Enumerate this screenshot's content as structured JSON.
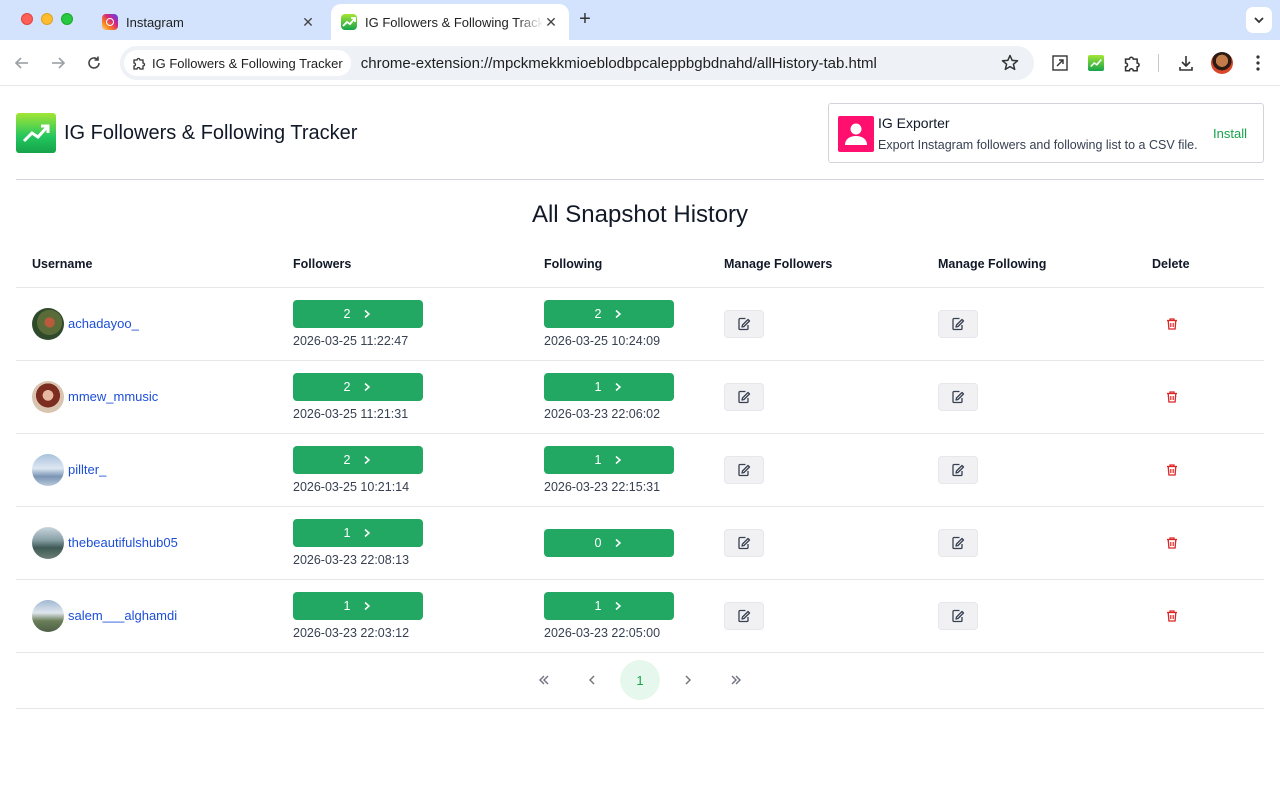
{
  "browser": {
    "tabs": [
      {
        "title": "Instagram",
        "active": false
      },
      {
        "title": "IG Followers & Following Tracker",
        "active": true
      }
    ],
    "origin_chip": "IG Followers & Following Tracker",
    "url": "chrome-extension://mpckmekkmioeblodbpcaleppbgbdnahd/allHistory-tab.html"
  },
  "header": {
    "app_title": "IG Followers & Following Tracker",
    "promo": {
      "title": "IG Exporter",
      "description": "Export Instagram followers and following list to a CSV file.",
      "action": "Install"
    }
  },
  "page_title": "All Snapshot History",
  "table": {
    "columns": [
      "Username",
      "Followers",
      "Following",
      "Manage Followers",
      "Manage Following",
      "Delete"
    ],
    "rows": [
      {
        "username": "achadayoo_",
        "followers": "2",
        "followers_time": "2026-03-25 11:22:47",
        "following": "2",
        "following_time": "2026-03-25 10:24:09"
      },
      {
        "username": "mmew_mmusic",
        "followers": "2",
        "followers_time": "2026-03-25 11:21:31",
        "following": "1",
        "following_time": "2026-03-23 22:06:02"
      },
      {
        "username": "pillter_",
        "followers": "2",
        "followers_time": "2026-03-25 10:21:14",
        "following": "1",
        "following_time": "2026-03-23 22:15:31"
      },
      {
        "username": "thebeautifulshub05",
        "followers": "1",
        "followers_time": "2026-03-23 22:08:13",
        "following": "0",
        "following_time": ""
      },
      {
        "username": "salem___alghamdi",
        "followers": "1",
        "followers_time": "2026-03-23 22:03:12",
        "following": "1",
        "following_time": "2026-03-23 22:05:00"
      }
    ]
  },
  "pagination": {
    "current_page": "1"
  },
  "colors": {
    "accent_green": "#22a862",
    "delete_red": "#dc2626",
    "link_blue": "#1d4ed8",
    "promo_pink": "#ff0f6e"
  }
}
